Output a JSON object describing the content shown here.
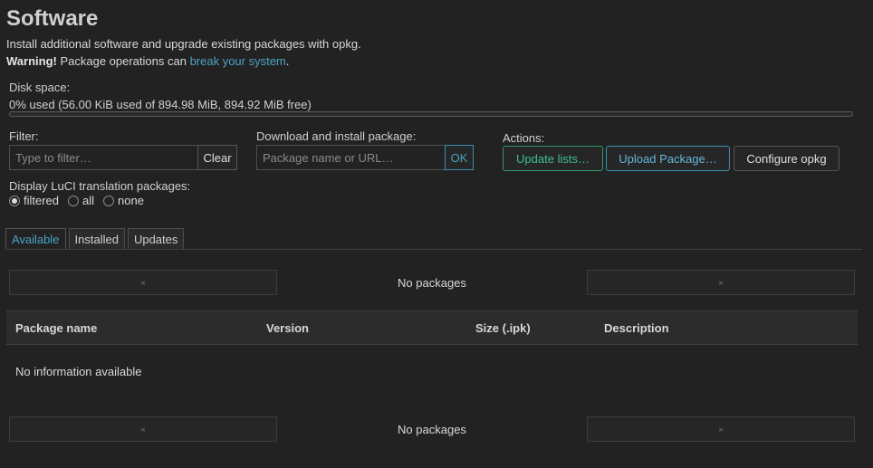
{
  "header": {
    "title": "Software",
    "description": "Install additional software and upgrade existing packages with opkg.",
    "warning_bold": "Warning!",
    "warning_text": " Package operations can ",
    "warning_link": "break your system",
    "warning_end": "."
  },
  "disk": {
    "label": "Disk space:",
    "usage_text": "0% used (56.00 KiB used of 894.98 MiB, 894.92 MiB free)",
    "used_fraction": 0.0
  },
  "filter": {
    "label": "Filter:",
    "placeholder": "Type to filter…",
    "clear_label": "Clear"
  },
  "download": {
    "label": "Download and install package:",
    "placeholder": "Package name or URL…",
    "ok_label": "OK"
  },
  "actions": {
    "label": "Actions:",
    "update_lists": "Update lists…",
    "upload_package": "Upload Package…",
    "configure_opkg": "Configure opkg"
  },
  "translation": {
    "label": "Display LuCI translation packages:",
    "options": [
      "filtered",
      "all",
      "none"
    ],
    "selected": "filtered"
  },
  "tabs": [
    "Available",
    "Installed",
    "Updates"
  ],
  "active_tab": "Available",
  "pager": {
    "prev_label": "«",
    "next_label": "»",
    "status": "No packages"
  },
  "table": {
    "columns": [
      "Package name",
      "Version",
      "Size (.ipk)",
      "Description"
    ],
    "empty_text": "No information available"
  },
  "colors": {
    "accent": "#4aa3c4",
    "success": "#3cc08a",
    "background": "#222222"
  }
}
